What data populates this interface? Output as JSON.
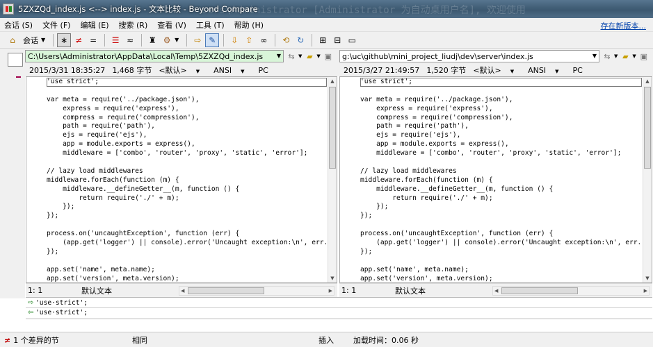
{
  "window": {
    "title": "5ZXZQd_index.js <--> index.js - 文本比较 - Beyond Compare",
    "ghost_text": "sers\\Administrator [Administrator 为自动桌用户名], 欢迎使用"
  },
  "menu": {
    "items": [
      "会话 (S)",
      "文件 (F)",
      "编辑 (E)",
      "搜索 (R)",
      "查看 (V)",
      "工具 (T)",
      "帮助 (H)"
    ],
    "new_version": "存在新版本..."
  },
  "toolbar": {
    "session_label": "会话"
  },
  "left": {
    "path": "C:\\Users\\Administrator\\AppData\\Local\\Temp\\5ZXZQd_index.js",
    "datetime": "2015/3/31 18:35:27",
    "size": "1,468 字节",
    "format": "<默认>",
    "encoding": "ANSI",
    "line_ending": "PC",
    "cursor": "1: 1",
    "mode": "默认文本"
  },
  "right": {
    "path": "g:\\uc\\github\\mini_project_liudj\\dev\\server\\index.js",
    "datetime": "2015/3/27 21:49:57",
    "size": "1,520 字节",
    "format": "<默认>",
    "encoding": "ANSI",
    "line_ending": "PC",
    "cursor": "1: 1",
    "mode": "默认文本"
  },
  "code_lines": [
    "'use strict';",
    "",
    "var meta = require('../package.json'),",
    "    express = require('express'),",
    "    compress = require('compression'),",
    "    path = require('path'),",
    "    ejs = require('ejs'),",
    "    app = module.exports = express(),",
    "    middleware = ['combo', 'router', 'proxy', 'static', 'error'];",
    "",
    "// lazy load middlewares",
    "middleware.forEach(function (m) {",
    "    middleware.__defineGetter__(m, function () {",
    "        return require('./' + m);",
    "    });",
    "});",
    "",
    "process.on('uncaughtException', function (err) {",
    "    (app.get('logger') || console).error('Uncaught exception:\\n', err.s",
    "});",
    "",
    "app.set('name', meta.name);",
    "app.set('version', meta.version);"
  ],
  "detail": {
    "line1": "'use·strict';",
    "line2": "'use·strict';"
  },
  "status": {
    "diff_count": "1 个差异的节",
    "same": "相同",
    "insert_mode": "插入",
    "load_time": "加载时间：0.06 秒"
  }
}
